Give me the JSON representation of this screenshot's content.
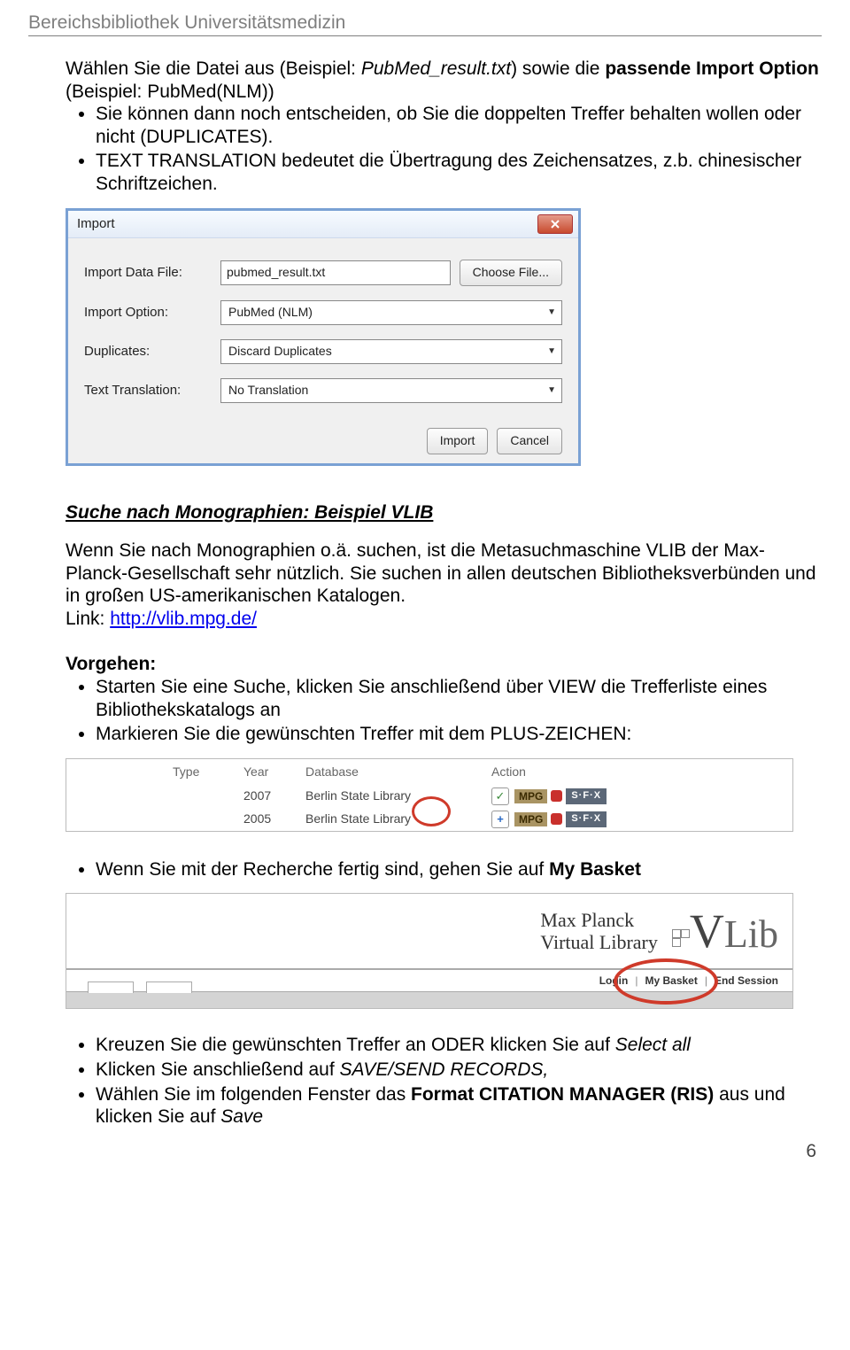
{
  "header": "Bereichsbibliothek Universitätsmedizin",
  "intro": {
    "line1_a": "Wählen Sie die Datei aus (Beispiel: ",
    "line1_file": "PubMed_result.txt",
    "line1_b": ") sowie die ",
    "line1_bold": "passende Import Option",
    "line1_c": " (Beispiel: PubMed(NLM))",
    "line2": "Sie können dann noch entscheiden, ob Sie die doppelten Treffer behalten wollen oder nicht (DUPLICATES).",
    "line3": "TEXT TRANSLATION bedeutet die Übertragung des Zeichensatzes, z.b. chinesischer Schriftzeichen."
  },
  "dialog": {
    "title": "Import",
    "labels": {
      "file": "Import Data File:",
      "option": "Import Option:",
      "duplicates": "Duplicates:",
      "translation": "Text Translation:"
    },
    "values": {
      "file": "pubmed_result.txt",
      "option": "PubMed (NLM)",
      "duplicates": "Discard Duplicates",
      "translation": "No Translation"
    },
    "buttons": {
      "choose": "Choose File...",
      "import": "Import",
      "cancel": "Cancel"
    }
  },
  "section2": {
    "heading": "Suche nach Monographien: Beispiel VLIB",
    "p1": "Wenn Sie nach Monographien o.ä. suchen, ist die Metasuchmaschine VLIB der Max-Planck-Gesellschaft sehr nützlich. Sie suchen in allen deutschen Bibliotheksverbünden und in großen US-amerikanischen Katalogen.",
    "link_label": "Link: ",
    "link_text": "http://vlib.mpg.de/",
    "vorgehen": "Vorgehen:",
    "bul1": "Starten Sie eine Suche, klicken Sie anschließend über VIEW die Trefferliste eines Bibliothekskatalogs an",
    "bul2": "Markieren Sie die gewünschten Treffer mit dem PLUS-ZEICHEN:"
  },
  "results": {
    "headers": {
      "type": "Type",
      "year": "Year",
      "db": "Database",
      "action": "Action"
    },
    "rows": [
      {
        "year": "2007",
        "db": "Berlin State Library",
        "icon": "check"
      },
      {
        "year": "2005",
        "db": "Berlin State Library",
        "icon": "plus"
      }
    ],
    "sfx": "S·F·X",
    "mpg": "MPG"
  },
  "afterResults": {
    "bul1_a": "Wenn Sie mit der Recherche fertig sind, gehen Sie auf ",
    "bul1_b": "My Basket"
  },
  "vlib": {
    "name1": "Max Planck",
    "name2": "Virtual Library",
    "links": {
      "login": "Login",
      "basket": "My Basket",
      "end": "End Session"
    }
  },
  "finalBullets": {
    "b1_a": "Kreuzen Sie die gewünschten Treffer an ODER klicken Sie auf ",
    "b1_b": "Select all",
    "b2_a": "Klicken Sie anschließend auf ",
    "b2_b": "SAVE/SEND RECORDS,",
    "b3_a": "Wählen Sie im folgenden Fenster das ",
    "b3_b": "Format CITATION MANAGER (RIS)",
    "b3_c": " aus und klicken Sie auf ",
    "b3_d": "Save"
  },
  "pagenum": "6"
}
